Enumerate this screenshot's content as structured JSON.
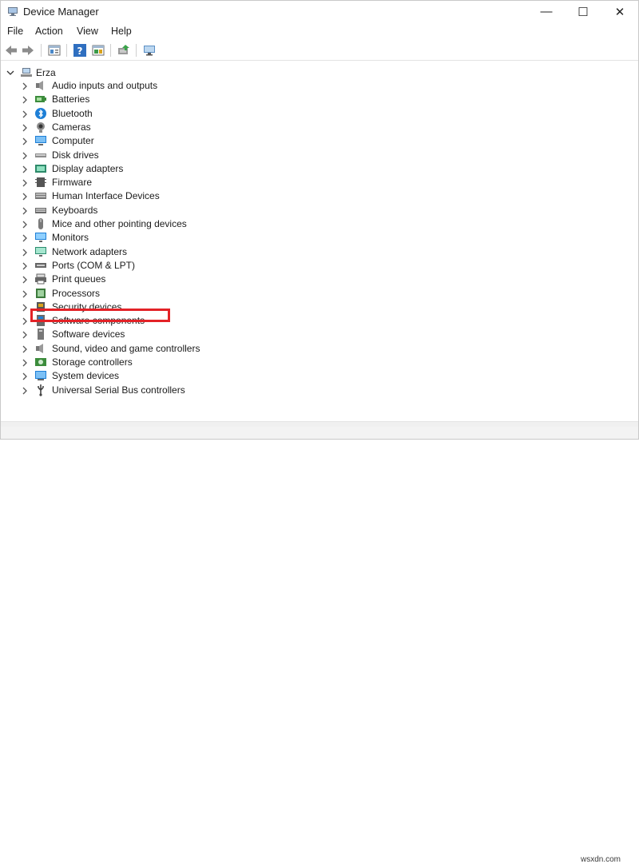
{
  "window": {
    "title": "Device Manager",
    "controls": {
      "minimize": "—",
      "maximize": "☐",
      "close": "✕"
    }
  },
  "menu": [
    {
      "label": "File"
    },
    {
      "label": "Action"
    },
    {
      "label": "View"
    },
    {
      "label": "Help"
    }
  ],
  "toolbar": {
    "buttons": [
      "back-arrow-icon",
      "forward-arrow-icon",
      "properties-icon",
      "help-icon",
      "details-view-icon",
      "update-driver-icon",
      "scan-hardware-icon"
    ]
  },
  "tree": {
    "root": {
      "label": "Erza",
      "expanded": true
    },
    "categories": [
      {
        "label": "Audio inputs and outputs",
        "icon": "speaker-icon"
      },
      {
        "label": "Batteries",
        "icon": "battery-icon"
      },
      {
        "label": "Bluetooth",
        "icon": "bluetooth-icon"
      },
      {
        "label": "Cameras",
        "icon": "camera-icon"
      },
      {
        "label": "Computer",
        "icon": "computer-icon"
      },
      {
        "label": "Disk drives",
        "icon": "disk-drive-icon"
      },
      {
        "label": "Display adapters",
        "icon": "display-adapter-icon"
      },
      {
        "label": "Firmware",
        "icon": "firmware-icon"
      },
      {
        "label": "Human Interface Devices",
        "icon": "hid-icon"
      },
      {
        "label": "Keyboards",
        "icon": "keyboard-icon"
      },
      {
        "label": "Mice and other pointing devices",
        "icon": "mouse-icon"
      },
      {
        "label": "Monitors",
        "icon": "monitor-icon"
      },
      {
        "label": "Network adapters",
        "icon": "network-adapter-icon",
        "highlighted": true
      },
      {
        "label": "Ports (COM & LPT)",
        "icon": "port-icon"
      },
      {
        "label": "Print queues",
        "icon": "printer-icon"
      },
      {
        "label": "Processors",
        "icon": "processor-icon"
      },
      {
        "label": "Security devices",
        "icon": "security-device-icon"
      },
      {
        "label": "Software components",
        "icon": "software-component-icon"
      },
      {
        "label": "Software devices",
        "icon": "software-device-icon"
      },
      {
        "label": "Sound, video and game controllers",
        "icon": "sound-controller-icon"
      },
      {
        "label": "Storage controllers",
        "icon": "storage-controller-icon"
      },
      {
        "label": "System devices",
        "icon": "system-device-icon"
      },
      {
        "label": "Universal Serial Bus controllers",
        "icon": "usb-icon"
      }
    ]
  },
  "colors": {
    "highlight": "#e32227",
    "accent": "#1e7fd6"
  },
  "watermark": "wsxdn.com"
}
